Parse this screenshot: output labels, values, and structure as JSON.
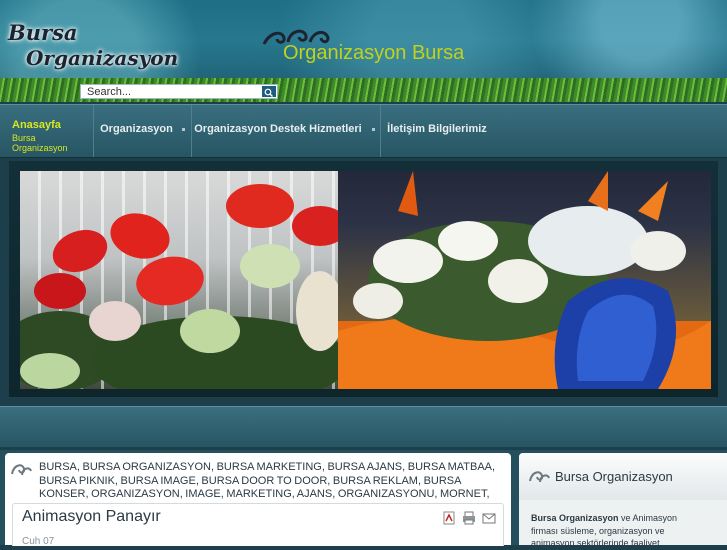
{
  "header": {
    "logo_line1": "Bursa",
    "logo_line2": "Organizasyon",
    "site_title": "Organizasyon Bursa",
    "search": {
      "placeholder": "Search..."
    }
  },
  "nav": {
    "items": [
      {
        "label": "Anasayfa",
        "sub": "Bursa Organizasyon"
      },
      {
        "label": "Organizasyon"
      },
      {
        "label": "Organizasyon Destek Hizmetleri"
      },
      {
        "label": "İletişim Bilgilerimiz"
      }
    ]
  },
  "main": {
    "tags": "BURSA, BURSA ORGANIZASYON, BURSA MARKETING, BURSA AJANS, BURSA MATBAA, BURSA PIKNIK, BURSA IMAGE, BURSA DOOR TO DOOR, BURSA REKLAM, BURSA KONSER, ORGANIZASYON, IMAGE, MARKETING, AJANS, ORGANIZASYONU, MORNET, DOOR TO DOOR,",
    "article_title": "Animasyon Panayır",
    "article_date": "Cuh 07"
  },
  "sidebar": {
    "title": "Bursa Organizasyon",
    "text_bold": "Bursa Organizasyon",
    "text_rest": " ve Animasyon firması süsleme, organizasyon ve animasyon sektörlerinde faaliyet"
  },
  "colors": {
    "accent": "#d8e820",
    "site_title": "#c2d21a",
    "nav_bg": "#2f6270"
  }
}
